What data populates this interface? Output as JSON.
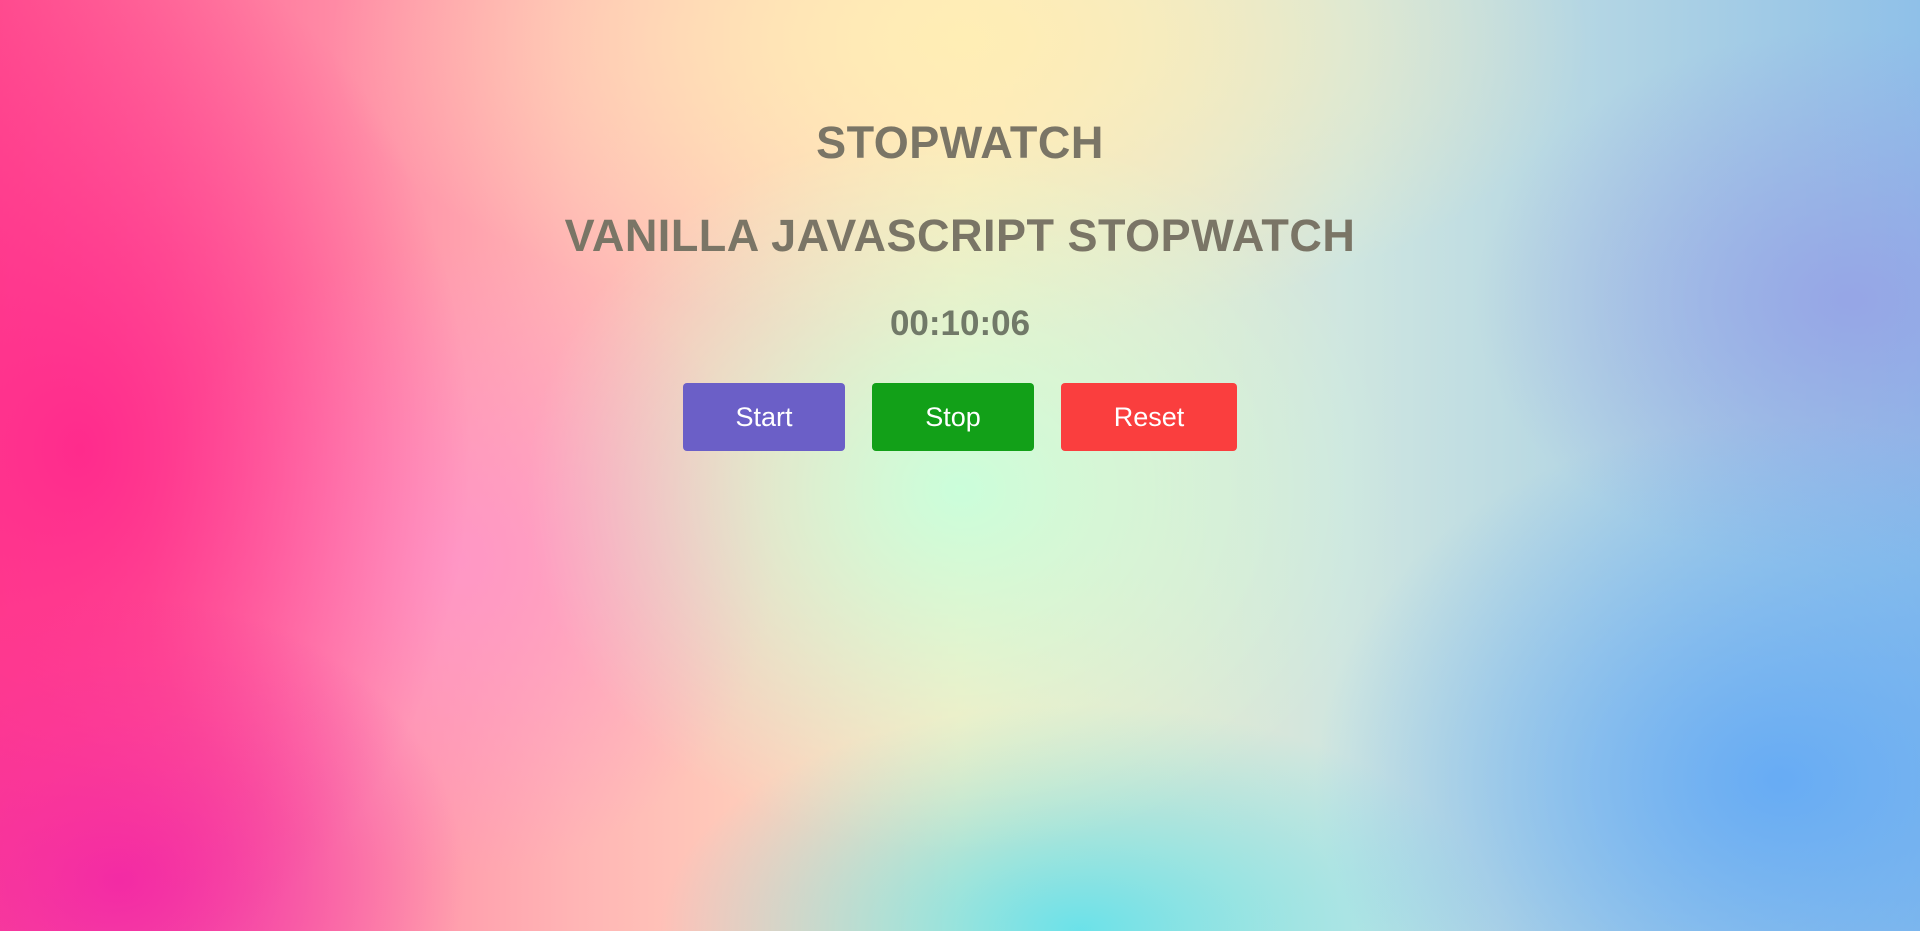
{
  "page": {
    "title": "STOPWATCH",
    "subtitle": "VANILLA JAVASCRIPT STOPWATCH",
    "time": "00:10:06"
  },
  "buttons": {
    "start": {
      "label": "Start",
      "color": "#6b5fc7"
    },
    "stop": {
      "label": "Stop",
      "color": "#12a018"
    },
    "reset": {
      "label": "Reset",
      "color": "#fa3e3e"
    }
  }
}
